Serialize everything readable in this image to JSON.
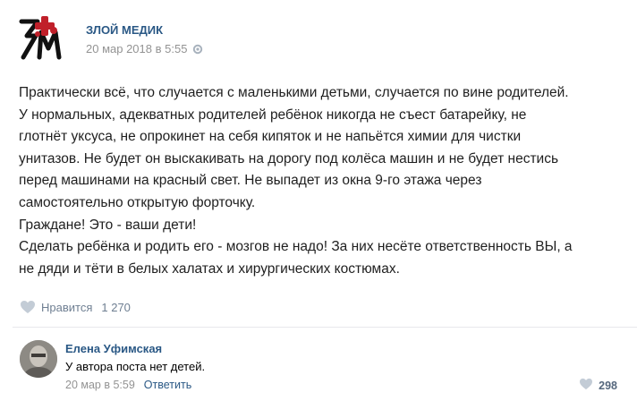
{
  "post": {
    "author": "ЗЛОЙ МЕДИК",
    "date": "20 мар 2018 в 5:55",
    "lines": [
      "Практически всё, что случается с маленькими детьми, случается по вине родителей.",
      "У нормальных, адекватных родителей ребёнок никогда не съест батарейку, не",
      "глотнёт уксуса, не опрокинет на себя кипяток и не напьётся химии для чистки",
      "унитазов. Не будет он выскакивать на дорогу под колёса машин и не будет нестись",
      "перед машинами на красный свет. Не выпадет из окна 9-го этажа через",
      "самостоятельно открытую форточку.",
      "Граждане! Это - ваши дети!",
      "Сделать ребёнка и родить его - мозгов не надо! За них несёте ответственность ВЫ, а",
      "не дяди и тёти в белых халатах и хирургических костюмах."
    ],
    "like_label": "Нравится",
    "like_count": "1 270"
  },
  "comment": {
    "author": "Елена Уфимская",
    "text": "У автора поста нет детей.",
    "date": "20 мар в 5:59",
    "reply_label": "Ответить",
    "like_count": "298"
  },
  "colors": {
    "link": "#2a5885",
    "muted": "#939393",
    "divider": "#e7e8ec",
    "logo_red": "#c0202a"
  }
}
